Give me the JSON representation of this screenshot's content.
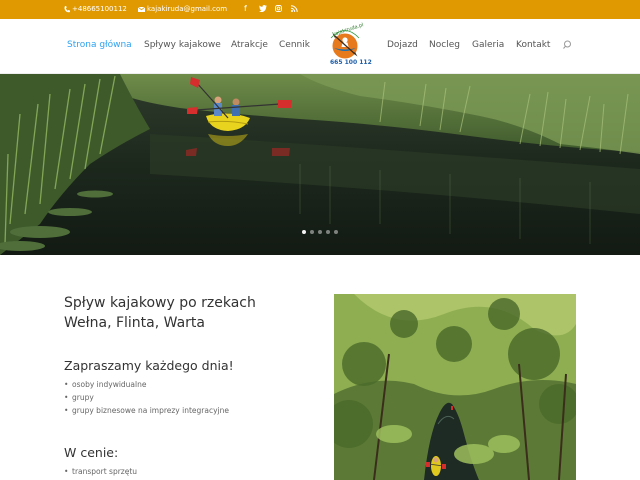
{
  "topbar": {
    "phone": "+48665100112",
    "email": "kajakiruda@gmail.com",
    "social": [
      "facebook-icon",
      "twitter-icon",
      "instagram-icon",
      "rss-icon"
    ],
    "bg_color": "#e09900"
  },
  "nav": {
    "items_left": [
      "Strona główna",
      "Spływy kajakowe",
      "Atrakcje",
      "Cennik"
    ],
    "items_right": [
      "Dojazd",
      "Nocleg",
      "Galeria",
      "Kontakt"
    ],
    "active_color": "#2ea3f2"
  },
  "logo": {
    "top_text": "kajakiruda.pl",
    "bottom_text": "665 100 112"
  },
  "hero": {
    "slide_count": 5,
    "active_slide": 1
  },
  "content": {
    "heading_line1": "Spływ kajakowy po rzekach",
    "heading_line2": "Wełna, Flinta, Warta",
    "invite_heading": "Zapraszamy każdego dnia!",
    "invite_list": [
      "osoby indywidualne",
      "grupy",
      "grupy biznesowe na imprezy integracyjne"
    ],
    "price_heading": "W cenie:",
    "price_list": [
      "transport sprzętu"
    ]
  }
}
